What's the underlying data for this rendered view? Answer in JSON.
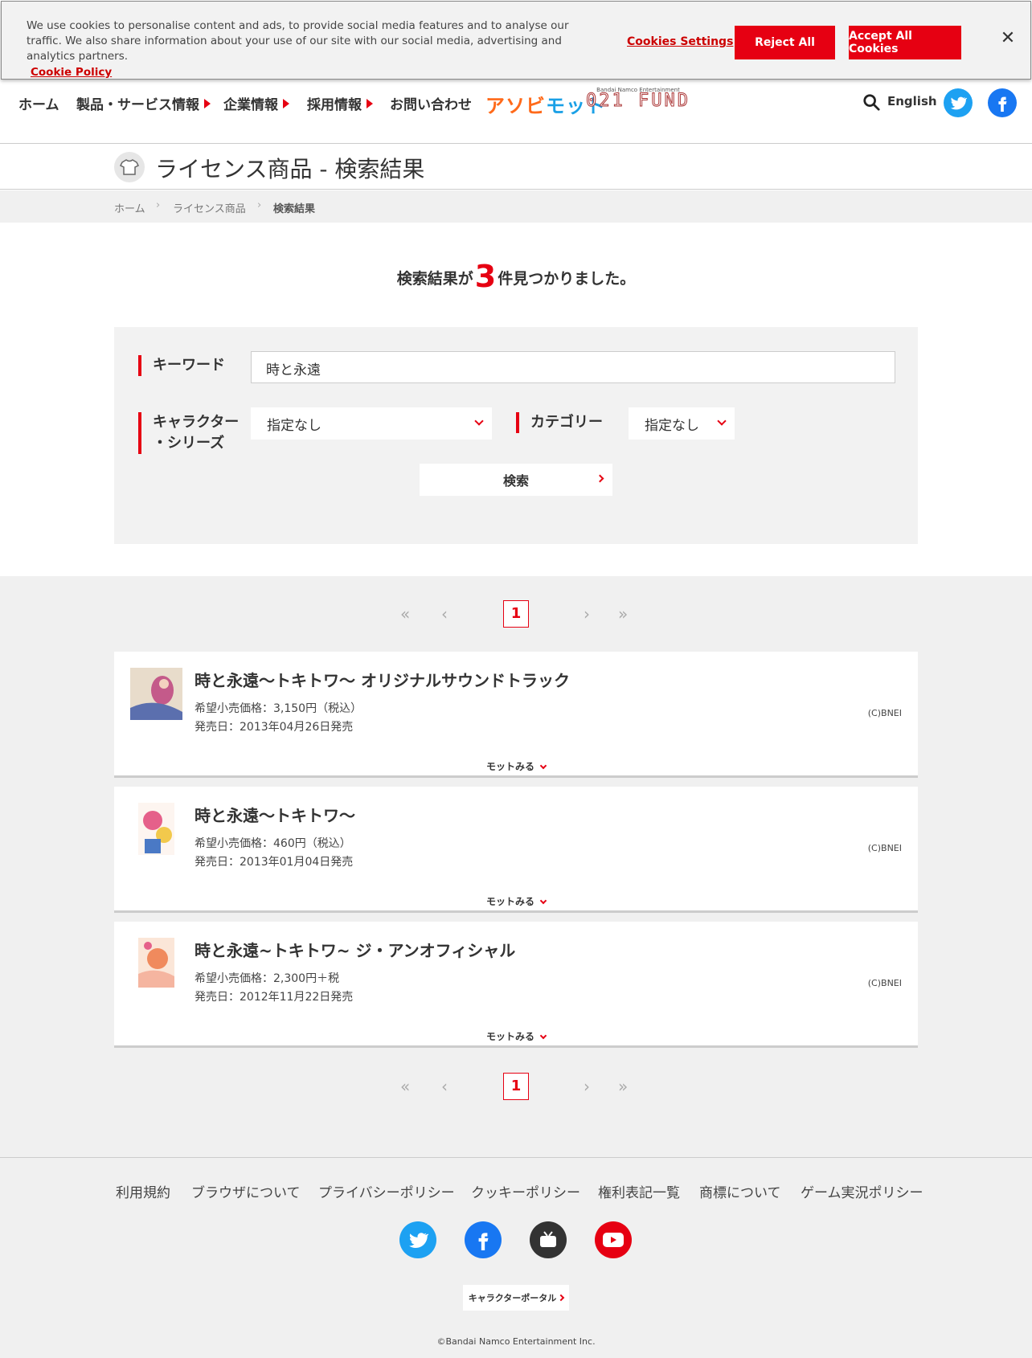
{
  "cookie": {
    "text": "We use cookies to personalise content and ads, to provide social media features and to analyse our traffic. We also share information about your use of our site with our social media, advertising and analytics partners.",
    "policy_link": "Cookie Policy",
    "settings_label": "Cookies Settings",
    "reject_label": "Reject All",
    "accept_label": "Accept All Cookies",
    "close_icon": "close-icon"
  },
  "nav": {
    "items": [
      "ホーム",
      "製品・サービス情報",
      "企業情報",
      "採用情報",
      "お問い合わせ"
    ],
    "logo_adomo_a": "アソビ",
    "logo_adomo_b": "モット",
    "logo_fund_small": "Bandai Namco Entertainment",
    "logo_fund_big": "021 FUND",
    "lang": "English"
  },
  "page": {
    "title": "ライセンス商品 - 検索結果",
    "breadcrumb": [
      "ホーム",
      "ライセンス商品",
      "検索結果"
    ]
  },
  "results_count": {
    "prefix": "検索結果が",
    "number": "3",
    "suffix": "件見つかりました。"
  },
  "search": {
    "keyword_label": "キーワード",
    "keyword_value": "時と永遠",
    "character_label_1": "キャラクター",
    "character_label_2": "・シリーズ",
    "character_value": "指定なし",
    "category_label": "カテゴリー",
    "category_value": "指定なし",
    "button_label": "検索"
  },
  "pager": {
    "current": "1",
    "first": "«",
    "prev": "‹",
    "next": "›",
    "last": "»"
  },
  "items": [
    {
      "title": "時と永遠～トキトワ～ オリジナルサウンドトラック",
      "price": "希望小売価格：3,150円（税込）",
      "date": "発売日：2013年04月26日発売",
      "copyright": "(C)BNEI",
      "more": "モットみる"
    },
    {
      "title": "時と永遠～トキトワ～",
      "price": "希望小売価格：460円（税込）",
      "date": "発売日：2013年01月04日発売",
      "copyright": "(C)BNEI",
      "more": "モットみる"
    },
    {
      "title": "時と永遠~トキトワ~ ジ・アンオフィシャル",
      "price": "希望小売価格：2,300円＋税",
      "date": "発売日：2012年11月22日発売",
      "copyright": "(C)BNEI",
      "more": "モットみる"
    }
  ],
  "footer": {
    "links": [
      "利用規約",
      "ブラウザについて",
      "プライバシーポリシー",
      "クッキーポリシー",
      "権利表記一覧",
      "商標について",
      "ゲーム実況ポリシー"
    ],
    "portal_label": "キャラクターポータル",
    "copyright": "©Bandai Namco Entertainment Inc."
  },
  "colors": {
    "accent": "#e60012",
    "twitter": "#1da1f2",
    "facebook": "#1877f2",
    "panel": "#f2f2f2"
  }
}
